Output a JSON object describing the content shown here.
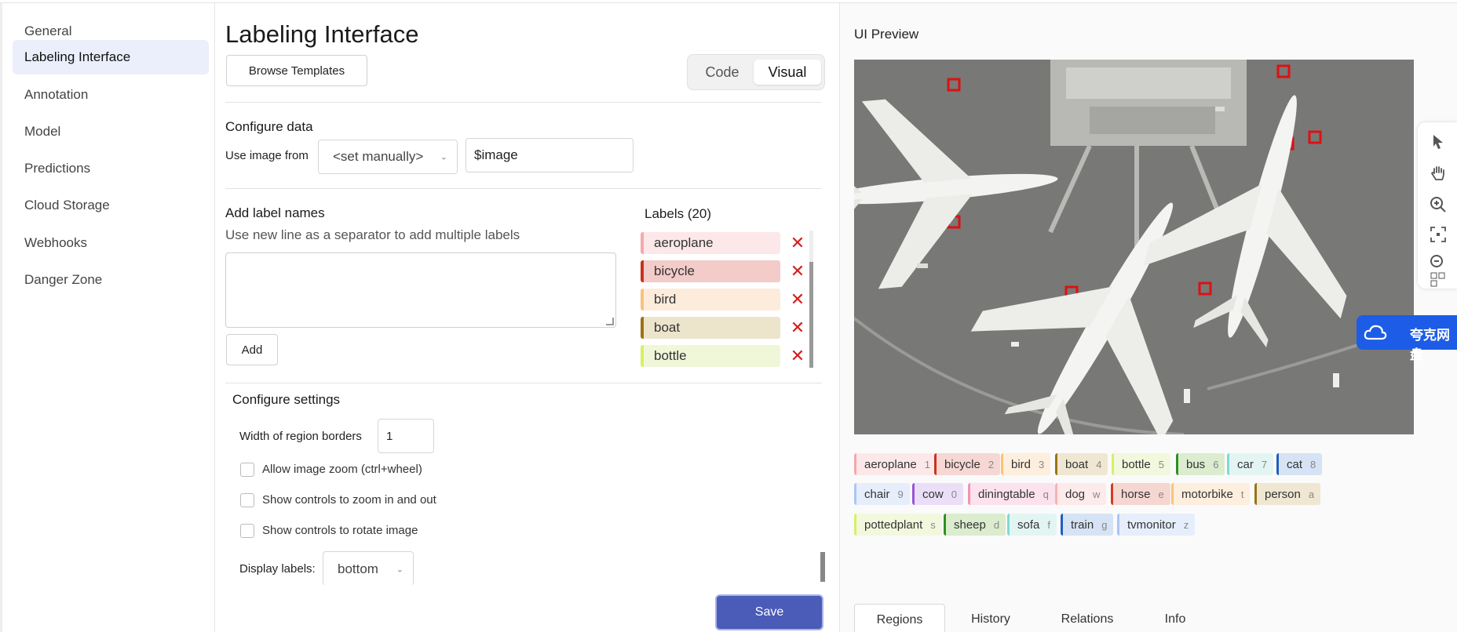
{
  "sidebar": {
    "items": [
      {
        "label": "General",
        "active": false
      },
      {
        "label": "Labeling Interface",
        "active": true
      },
      {
        "label": "Annotation",
        "active": false
      },
      {
        "label": "Model",
        "active": false
      },
      {
        "label": "Predictions",
        "active": false
      },
      {
        "label": "Cloud Storage",
        "active": false
      },
      {
        "label": "Webhooks",
        "active": false
      },
      {
        "label": "Danger Zone",
        "active": false
      }
    ]
  },
  "main": {
    "title": "Labeling Interface",
    "browse_templates": "Browse Templates",
    "view_toggle": {
      "code": "Code",
      "visual": "Visual",
      "selected": "Visual"
    },
    "configure_data": {
      "title": "Configure data",
      "use_image_from": "Use image from",
      "source_select": "<set manually>",
      "image_var": "$image"
    },
    "add_labels": {
      "title": "Add label names",
      "hint": "Use new line as a separator to add multiple labels",
      "textarea_value": "",
      "add_button": "Add"
    },
    "labels_list": {
      "title": "Labels (20)",
      "items": [
        {
          "name": "aeroplane",
          "color": "#f6a7ab",
          "bg": "#fde8e9"
        },
        {
          "name": "bicycle",
          "color": "#c9321c",
          "bg": "#f3cbc8"
        },
        {
          "name": "bird",
          "color": "#f9c27a",
          "bg": "#fdecdb"
        },
        {
          "name": "boat",
          "color": "#9b7214",
          "bg": "#ede4cc"
        },
        {
          "name": "bottle",
          "color": "#d6f063",
          "bg": "#f0f7d9"
        }
      ]
    },
    "configure_settings": {
      "title": "Configure settings",
      "border_width_label": "Width of region borders",
      "border_width_value": "1",
      "zoom_label": "Allow image zoom (ctrl+wheel)",
      "zoom_controls_label": "Show controls to zoom in and out",
      "rotate_label": "Show controls to rotate image",
      "display_labels_label": "Display labels:",
      "display_labels_value": "bottom"
    },
    "save": "Save"
  },
  "preview": {
    "title": "UI Preview",
    "cloud_badge": "夸克网盘",
    "tags": [
      {
        "name": "aeroplane",
        "key": "1",
        "color": "#f6a7ab",
        "bg": "#fde8e9"
      },
      {
        "name": "bicycle",
        "key": "2",
        "color": "#c9321c",
        "bg": "#f6d7d3"
      },
      {
        "name": "bird",
        "key": "3",
        "color": "#f9c27a",
        "bg": "#fdeedd"
      },
      {
        "name": "boat",
        "key": "4",
        "color": "#9b7214",
        "bg": "#efe7d2"
      },
      {
        "name": "bottle",
        "key": "5",
        "color": "#d6f063",
        "bg": "#f2f8dd"
      },
      {
        "name": "bus",
        "key": "6",
        "color": "#2f8f1f",
        "bg": "#dbeccf"
      },
      {
        "name": "car",
        "key": "7",
        "color": "#7fd9d3",
        "bg": "#e3f5f3"
      },
      {
        "name": "cat",
        "key": "8",
        "color": "#1f5fbf",
        "bg": "#d6e3f4"
      },
      {
        "name": "chair",
        "key": "9",
        "color": "#aac6f5",
        "bg": "#e6eefc"
      },
      {
        "name": "cow",
        "key": "0",
        "color": "#9a52d9",
        "bg": "#ebdff7"
      },
      {
        "name": "diningtable",
        "key": "q",
        "color": "#f291b6",
        "bg": "#fbe2ec"
      },
      {
        "name": "dog",
        "key": "w",
        "color": "#f7b3b6",
        "bg": "#fdeaea"
      },
      {
        "name": "horse",
        "key": "e",
        "color": "#d23b24",
        "bg": "#f6d6d1"
      },
      {
        "name": "motorbike",
        "key": "t",
        "color": "#f7c37b",
        "bg": "#fdeedd"
      },
      {
        "name": "person",
        "key": "a",
        "color": "#9a7418",
        "bg": "#efe7d2"
      },
      {
        "name": "pottedplant",
        "key": "s",
        "color": "#d7f066",
        "bg": "#f2f8dd"
      },
      {
        "name": "sheep",
        "key": "d",
        "color": "#2f8f1f",
        "bg": "#dbeccf"
      },
      {
        "name": "sofa",
        "key": "f",
        "color": "#7fd9d3",
        "bg": "#e3f5f3"
      },
      {
        "name": "train",
        "key": "g",
        "color": "#1f5fbf",
        "bg": "#d6e3f4"
      },
      {
        "name": "tvmonitor",
        "key": "z",
        "color": "#aac6f5",
        "bg": "#e6eefc"
      }
    ],
    "tabs": [
      {
        "label": "Regions",
        "active": true
      },
      {
        "label": "History",
        "active": false
      },
      {
        "label": "Relations",
        "active": false
      },
      {
        "label": "Info",
        "active": false
      }
    ]
  }
}
